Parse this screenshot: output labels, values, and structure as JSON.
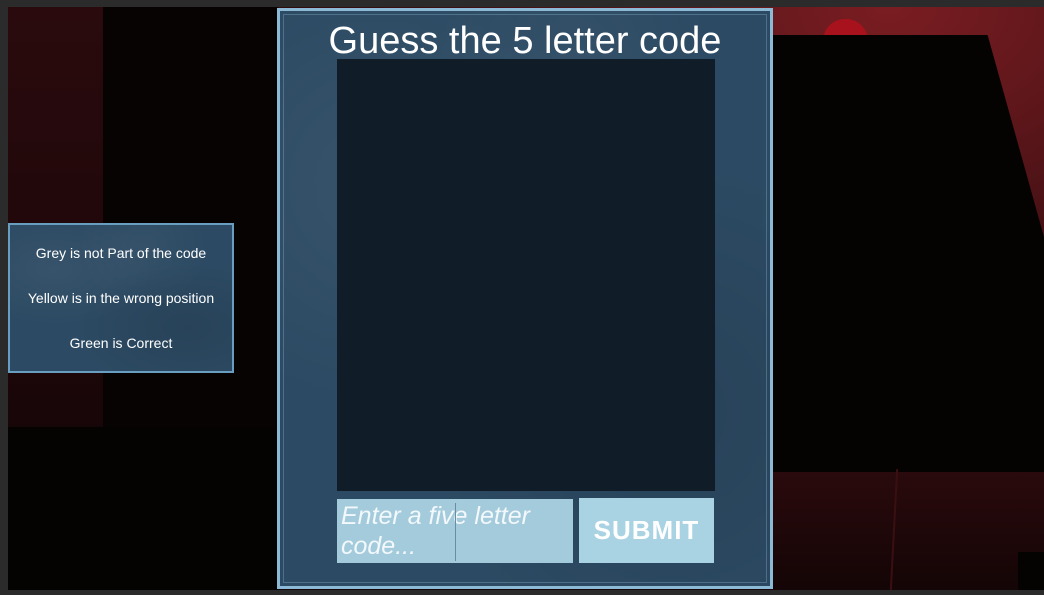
{
  "legend": {
    "grey": "Grey is not Part of the code",
    "yellow": "Yellow is in the wrong position",
    "green": "Green is Correct"
  },
  "main": {
    "title": "Guess the 5 letter code",
    "input_placeholder": "Enter a five letter code...",
    "input_value": "",
    "submit_label": "SUBMIT"
  },
  "colors": {
    "panel": "#2c4a63",
    "panel_border": "#8bb9d6",
    "guess_area": "#111c29",
    "input_bg": "#a4cbdb",
    "submit_bg": "#a9d2e3"
  }
}
